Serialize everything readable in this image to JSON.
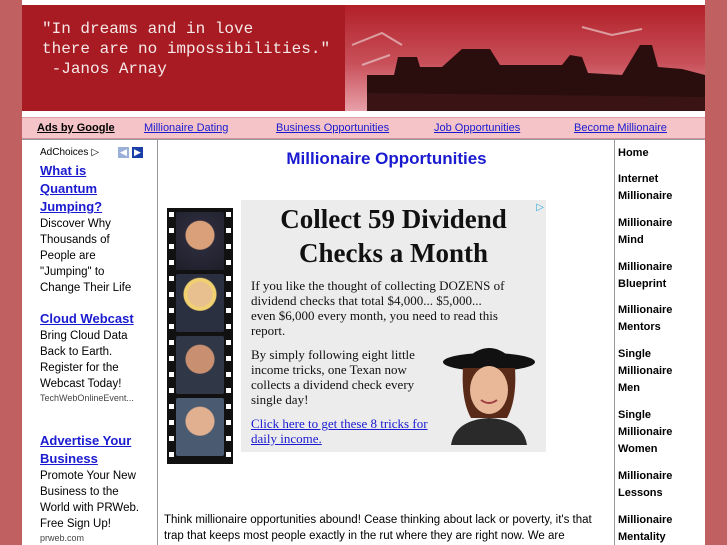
{
  "header": {
    "quote_line1": "\"In dreams and in love",
    "quote_line2": "there are no impossibilities.\"",
    "quote_line3": "-Janos Arnay"
  },
  "navbar": {
    "ads_label": "Ads by Google",
    "links": [
      "Millionaire Dating",
      "Business Opportunities",
      "Job Opportunities",
      "Become Millionaire"
    ]
  },
  "left_ads": {
    "adchoices_label": "AdChoices",
    "ads": [
      {
        "title_lines": [
          "What is",
          "Quantum",
          "Jumping?"
        ],
        "desc_lines": [
          "Discover Why",
          "Thousands of",
          "People are",
          "\"Jumping\" to",
          "Change Their Life"
        ],
        "url": ""
      },
      {
        "title_lines": [
          "Cloud Webcast"
        ],
        "desc_lines": [
          "Bring Cloud Data",
          "Back to Earth.",
          "Register for the",
          "Webcast Today!"
        ],
        "url": "TechWebOnlineEvent..."
      },
      {
        "title_lines": [
          "Advertise Your",
          "Business"
        ],
        "desc_lines": [
          "Promote Your New",
          "Business to the",
          "World with PRWeb.",
          "Free Sign Up!"
        ],
        "url": "prweb.com"
      }
    ]
  },
  "main": {
    "title": "Millionaire Opportunities",
    "ad": {
      "headline_line1": "Collect 59 Dividend",
      "headline_line2": "Checks a Month",
      "p1_lines": [
        "If you like the thought of collecting DOZENS of",
        "dividend checks that total $4,000... $5,000...",
        "even $6,000 every month, you need to read this",
        "report."
      ],
      "p2_lines": [
        "By simply following eight little",
        "income tricks, one Texan now",
        "collects a dividend check every",
        "single day!"
      ],
      "link_lines": [
        "Click here to get these 8 tricks for",
        "daily income."
      ]
    },
    "body_line1": "Think millionaire opportunities abound! Cease thinking about lack or poverty, it's that",
    "body_line2": "trap that keeps most people exactly in the rut where they are right now. We are"
  },
  "right_nav": {
    "items": [
      {
        "lines": [
          "Home"
        ]
      },
      {
        "lines": [
          "Internet",
          "Millionaire"
        ]
      },
      {
        "lines": [
          "Millionaire",
          "Mind"
        ]
      },
      {
        "lines": [
          "Millionaire",
          "Blueprint"
        ]
      },
      {
        "lines": [
          "Millionaire",
          "Mentors"
        ]
      },
      {
        "lines": [
          "Single",
          "Millionaire",
          "Men"
        ]
      },
      {
        "lines": [
          "Single",
          "Millionaire",
          "Women"
        ]
      },
      {
        "lines": [
          "Millionaire",
          "Lessons"
        ]
      },
      {
        "lines": [
          "Millionaire",
          "Mentality"
        ]
      }
    ]
  },
  "colors": {
    "brand_red": "#a81b22",
    "link_blue": "#1a1ad0",
    "nav_pink": "#f4c4c8"
  }
}
